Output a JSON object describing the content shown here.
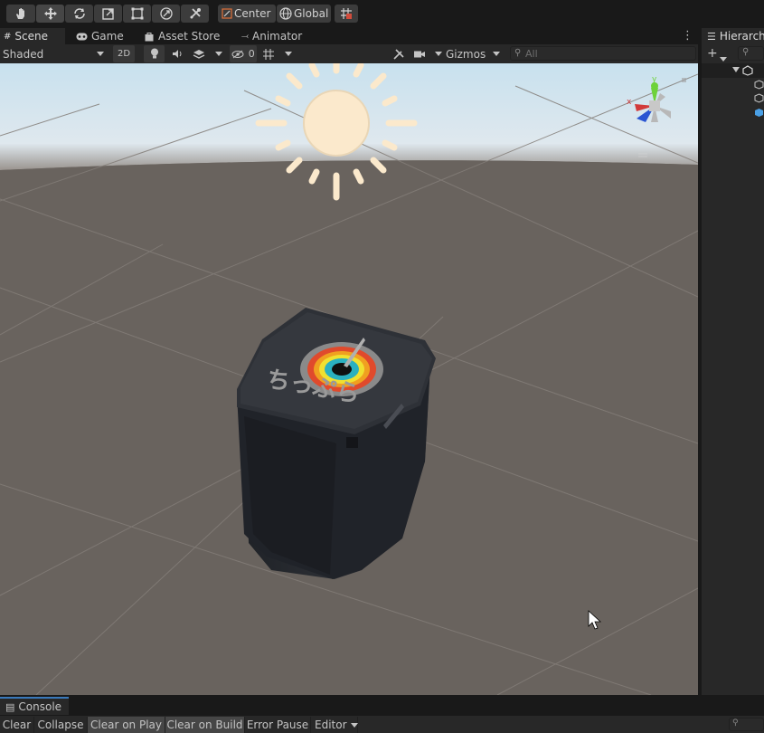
{
  "toolbar": {
    "tools": [
      "hand-tool",
      "move-tool",
      "rotate-tool",
      "scale-tool",
      "rect-tool",
      "transform-tool",
      "custom-tool"
    ],
    "pivot_label": "Center",
    "space_label": "Global"
  },
  "tabs": [
    {
      "label": "Scene",
      "icon": "scene-grid-icon"
    },
    {
      "label": "Game",
      "icon": "gamepad-icon"
    },
    {
      "label": "Asset Store",
      "icon": "bag-icon"
    },
    {
      "label": "Animator",
      "icon": "animator-icon"
    }
  ],
  "scene_toolbar": {
    "draw_mode": "Shaded",
    "mode_2d": "2D",
    "hidden_count": "0",
    "gizmos_label": "Gizmos",
    "search_placeholder": "All"
  },
  "gizmo": {
    "y_label": "y",
    "x_label": "x"
  },
  "watch_face_text": "ちっぷら",
  "hierarchy": {
    "tab_label": "Hierarch"
  },
  "console": {
    "tab_label": "Console",
    "buttons": [
      "Clear",
      "Collapse",
      "Clear on Play",
      "Clear on Build",
      "Error Pause",
      "Editor"
    ]
  },
  "colors": {
    "accent_blue": "#3a79bb",
    "viewport_ground": "#6a6560",
    "sky": "#d0e6f0"
  }
}
